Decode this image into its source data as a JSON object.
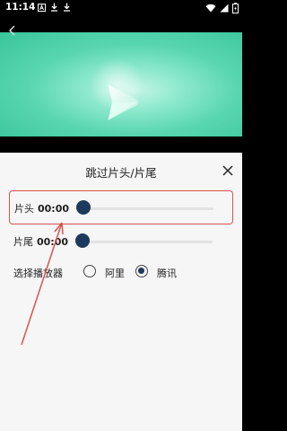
{
  "status_bar": {
    "time": "11:14",
    "icons_left": [
      "notification-a-icon",
      "download-icon",
      "download-icon"
    ],
    "icons_right": [
      "wifi-icon",
      "signal-icon",
      "battery-icon"
    ]
  },
  "video": {
    "back_icon": "chevron-left-icon",
    "logo_icon": "play-logo-icon"
  },
  "sheet": {
    "title": "跳过片头/片尾",
    "close_icon": "close-icon",
    "opening": {
      "label": "片头",
      "time": "00:00",
      "progress": 0
    },
    "ending": {
      "label": "片尾",
      "time": "00:00",
      "progress": 0
    },
    "player": {
      "label": "选择播放器",
      "options": [
        {
          "label": "阿里",
          "selected": false
        },
        {
          "label": "腾讯",
          "selected": true
        }
      ]
    }
  },
  "colors": {
    "accent": "#1d3a5c",
    "highlight_box": "#d9534f",
    "annotation_arrow": "#d9534f",
    "sheet_bg": "#f6f6f6"
  }
}
